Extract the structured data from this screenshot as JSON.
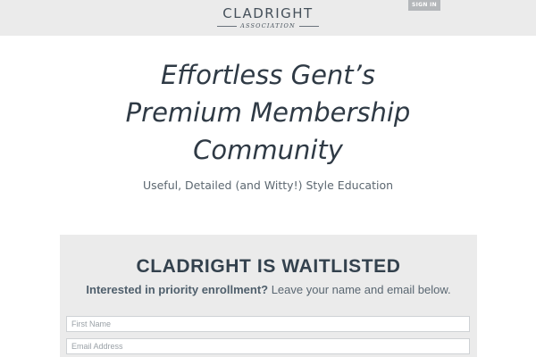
{
  "header": {
    "logo_main": "CLADRIGHT",
    "logo_sub": "ASSOCIATION",
    "signin_label": "SIGN IN"
  },
  "hero": {
    "title_lines": [
      "Effortless Gent’s",
      "Premium Membership",
      "Community"
    ],
    "subtitle": "Useful, Detailed (and Witty!) Style Education"
  },
  "waitlist": {
    "title": "CLADRIGHT IS WAITLISTED",
    "lead_bold": "Interested in priority enrollment?",
    "lead_rest": " Leave your name and email below.",
    "first_name_placeholder": "First Name",
    "email_placeholder": "Email Address"
  }
}
